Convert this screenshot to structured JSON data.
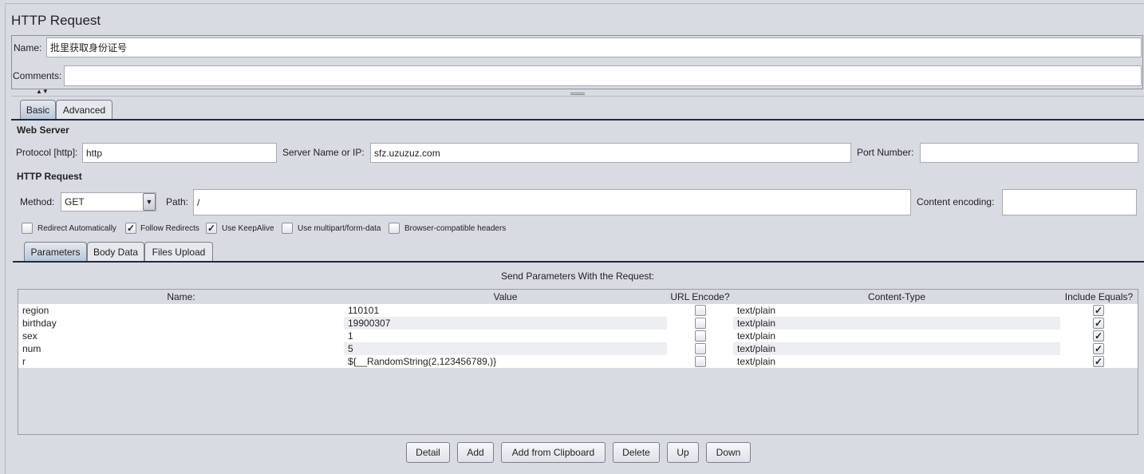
{
  "title": "HTTP Request",
  "name_label": "Name:",
  "name_value": "批里获取身份证号",
  "comments_label": "Comments:",
  "comments_value": "",
  "tabs": [
    {
      "label": "Basic",
      "selected": true
    },
    {
      "label": "Advanced",
      "selected": false
    }
  ],
  "web_server": {
    "heading": "Web Server",
    "protocol_label": "Protocol [http]:",
    "protocol_value": "http",
    "server_label": "Server Name or IP:",
    "server_value": "sfz.uzuzuz.com",
    "port_label": "Port Number:",
    "port_value": ""
  },
  "http_request": {
    "heading": "HTTP Request",
    "method_label": "Method:",
    "method_value": "GET",
    "path_label": "Path:",
    "path_value": "/",
    "encoding_label": "Content encoding:",
    "encoding_value": ""
  },
  "options": [
    {
      "label": "Redirect Automatically",
      "checked": false
    },
    {
      "label": "Follow Redirects",
      "checked": true
    },
    {
      "label": "Use KeepAlive",
      "checked": true
    },
    {
      "label": "Use multipart/form-data",
      "checked": false
    },
    {
      "label": "Browser-compatible headers",
      "checked": false
    }
  ],
  "subtabs": [
    {
      "label": "Parameters",
      "selected": true
    },
    {
      "label": "Body Data",
      "selected": false
    },
    {
      "label": "Files Upload",
      "selected": false
    }
  ],
  "params_caption": "Send Parameters With the Request:",
  "columns": [
    "Name:",
    "Value",
    "URL Encode?",
    "Content-Type",
    "Include Equals?"
  ],
  "rows": [
    {
      "name": "region",
      "value": "110101",
      "url_encode": false,
      "content_type": "text/plain",
      "include_equals": true
    },
    {
      "name": "birthday",
      "value": "19900307",
      "url_encode": false,
      "content_type": "text/plain",
      "include_equals": true
    },
    {
      "name": "sex",
      "value": "1",
      "url_encode": false,
      "content_type": "text/plain",
      "include_equals": true
    },
    {
      "name": "num",
      "value": "5",
      "url_encode": false,
      "content_type": "text/plain",
      "include_equals": true
    },
    {
      "name": "r",
      "value": "${__RandomString(2,123456789,)}",
      "url_encode": false,
      "content_type": "text/plain",
      "include_equals": true
    }
  ],
  "buttons": [
    "Detail",
    "Add",
    "Add from Clipboard",
    "Delete",
    "Up",
    "Down"
  ]
}
